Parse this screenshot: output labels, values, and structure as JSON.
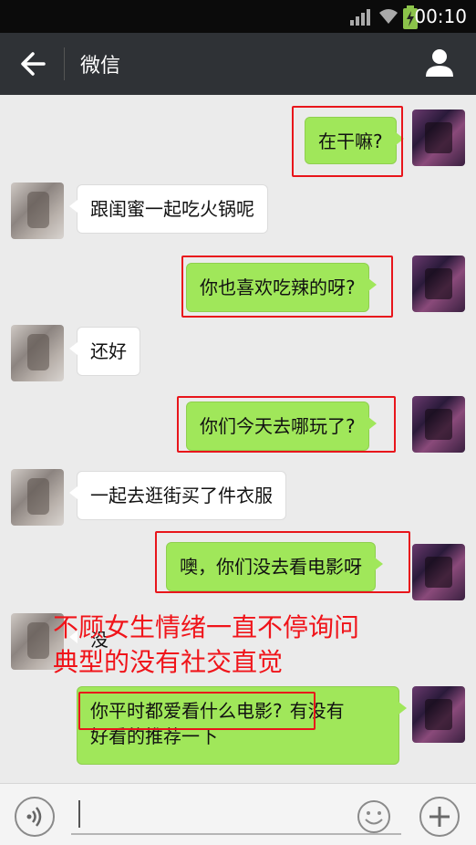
{
  "status_bar": {
    "time": "00:10"
  },
  "nav": {
    "title": "微信"
  },
  "messages": [
    {
      "side": "right",
      "text": "在干嘛?"
    },
    {
      "side": "left",
      "text": "跟闺蜜一起吃火锅呢"
    },
    {
      "side": "right",
      "text": "你也喜欢吃辣的呀?"
    },
    {
      "side": "left",
      "text": "还好"
    },
    {
      "side": "right",
      "text": "你们今天去哪玩了?"
    },
    {
      "side": "left",
      "text": "一起去逛街买了件衣服"
    },
    {
      "side": "right",
      "text": "噢，你们没去看电影呀"
    },
    {
      "side": "left",
      "text": "没"
    },
    {
      "side": "right",
      "line1_part1": "你平时都爱看什么电影?",
      "line1_part2": "有没有",
      "line2": "好看的推荐一下"
    }
  ],
  "annotation": {
    "line1": "不顾女生情绪一直不停询问",
    "line2": "典型的没有社交直觉"
  },
  "colors": {
    "annotation": "#f0141a",
    "my_bubble": "#a0e75a",
    "nav_bg": "#2f3236"
  }
}
